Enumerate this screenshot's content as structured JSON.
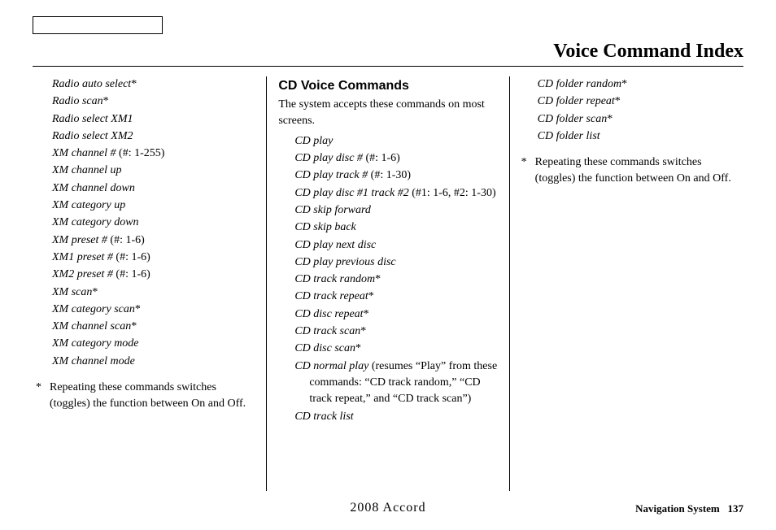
{
  "header": {
    "title": "Voice Command Index"
  },
  "col1": {
    "commands": [
      {
        "cmd": "Radio auto select",
        "suffix": "*"
      },
      {
        "cmd": "Radio scan",
        "suffix": "*"
      },
      {
        "cmd": "Radio select XM1",
        "suffix": ""
      },
      {
        "cmd": "Radio select XM2",
        "suffix": ""
      },
      {
        "cmd": "XM channel #",
        "suffix": " (#: 1-255)"
      },
      {
        "cmd": "XM channel up",
        "suffix": ""
      },
      {
        "cmd": "XM channel down",
        "suffix": ""
      },
      {
        "cmd": "XM category up",
        "suffix": ""
      },
      {
        "cmd": "XM category down",
        "suffix": ""
      },
      {
        "cmd": "XM preset #",
        "suffix": " (#: 1-6)"
      },
      {
        "cmd": "XM1 preset #",
        "suffix": " (#: 1-6)"
      },
      {
        "cmd": "XM2 preset #",
        "suffix": " (#: 1-6)"
      },
      {
        "cmd": "XM scan",
        "suffix": "*"
      },
      {
        "cmd": "XM category scan",
        "suffix": "*"
      },
      {
        "cmd": "XM channel scan",
        "suffix": "*"
      },
      {
        "cmd": "XM category mode",
        "suffix": ""
      },
      {
        "cmd": "XM channel mode",
        "suffix": ""
      }
    ],
    "note_marker": "*",
    "note_text": "Repeating these commands switches (toggles) the function between On and Off."
  },
  "col2": {
    "section_title": "CD Voice Commands",
    "intro": "The system accepts these commands on most screens.",
    "commands": [
      {
        "cmd": "CD play",
        "suffix": ""
      },
      {
        "cmd": "CD play disc #",
        "suffix": " (#: 1-6)"
      },
      {
        "cmd": "CD play track #",
        "suffix": " (#: 1-30)"
      },
      {
        "cmd": "CD play disc #1 track #2",
        "suffix": " (#1: 1-6, #2: 1-30)",
        "wrap": true
      },
      {
        "cmd": "CD skip forward",
        "suffix": ""
      },
      {
        "cmd": "CD skip back",
        "suffix": ""
      },
      {
        "cmd": "CD play next disc",
        "suffix": ""
      },
      {
        "cmd": "CD play previous disc",
        "suffix": ""
      },
      {
        "cmd": "CD track random",
        "suffix": "*"
      },
      {
        "cmd": "CD track repeat",
        "suffix": "*"
      },
      {
        "cmd": "CD disc repeat",
        "suffix": "*"
      },
      {
        "cmd": "CD track scan",
        "suffix": "*"
      },
      {
        "cmd": "CD disc scan",
        "suffix": "*"
      },
      {
        "cmd": "CD normal play",
        "suffix": " (resumes “Play” from these commands: “CD track random,” “CD track repeat,” and “CD track scan”)",
        "wrap": true
      },
      {
        "cmd": "CD track list",
        "suffix": ""
      }
    ]
  },
  "col3": {
    "commands": [
      {
        "cmd": "CD folder random",
        "suffix": "*"
      },
      {
        "cmd": "CD folder repeat",
        "suffix": "*"
      },
      {
        "cmd": "CD folder scan",
        "suffix": "*"
      },
      {
        "cmd": "CD folder list",
        "suffix": ""
      }
    ],
    "note_marker": "*",
    "note_text": "Repeating these commands switches (toggles) the function between On and Off."
  },
  "footer": {
    "center": "2008  Accord",
    "right_label": "Navigation System",
    "page_num": "137"
  }
}
